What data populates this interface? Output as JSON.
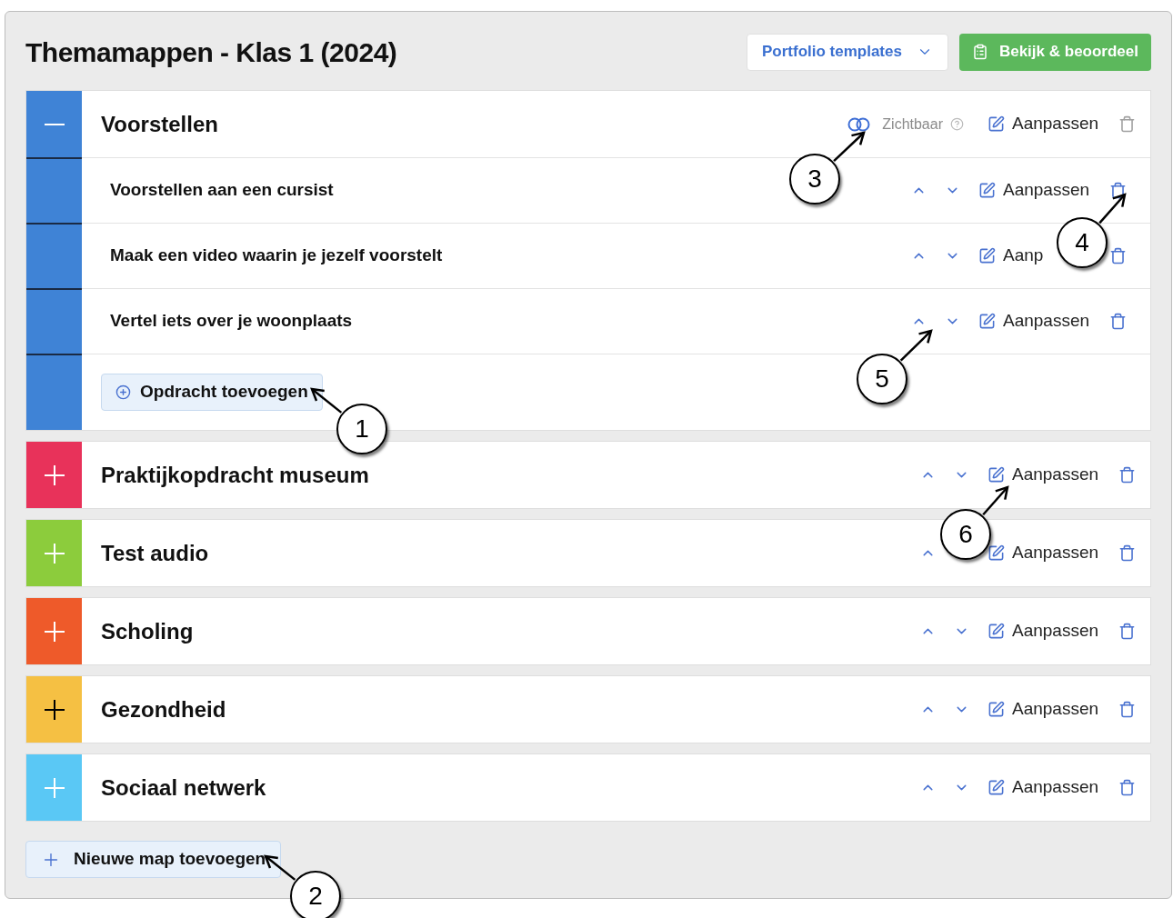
{
  "title": "Themamappen - Klas 1 (2024)",
  "header_buttons": {
    "templates": "Portfolio templates",
    "review": "Bekijk & beoordeel"
  },
  "folders": [
    {
      "title": "Voorstellen",
      "color": "#3f83d6",
      "expanded": true,
      "icon_dark": false,
      "visibility": {
        "label": "Zichtbaar",
        "on": true
      },
      "edit_label": "Aanpassen",
      "items": [
        {
          "title": "Voorstellen aan een cursist",
          "edit_label": "Aanpassen"
        },
        {
          "title": "Maak een video waarin je jezelf voorstelt",
          "edit_label": "Aanp"
        },
        {
          "title": "Vertel iets over je woonplaats",
          "edit_label": "Aanpassen"
        }
      ],
      "add_label": "Opdracht toevoegen"
    },
    {
      "title": "Praktijkopdracht museum",
      "color": "#e8325a",
      "expanded": false,
      "icon_dark": false,
      "move_down": true,
      "edit_label": "Aanpassen"
    },
    {
      "title": "Test audio",
      "color": "#8ccc3c",
      "expanded": false,
      "icon_dark": false,
      "move_down": false,
      "edit_label": "Aanpassen"
    },
    {
      "title": "Scholing",
      "color": "#ee5a2a",
      "expanded": false,
      "icon_dark": false,
      "move_down": true,
      "edit_label": "Aanpassen"
    },
    {
      "title": "Gezondheid",
      "color": "#f5c043",
      "expanded": false,
      "icon_dark": true,
      "move_down": true,
      "edit_label": "Aanpassen"
    },
    {
      "title": "Sociaal netwerk",
      "color": "#5ac8f5",
      "expanded": false,
      "icon_dark": false,
      "move_down": true,
      "edit_label": "Aanpassen"
    }
  ],
  "new_folder_label": "Nieuwe map toevoegen",
  "callouts": [
    "1",
    "2",
    "3",
    "4",
    "5",
    "6"
  ]
}
